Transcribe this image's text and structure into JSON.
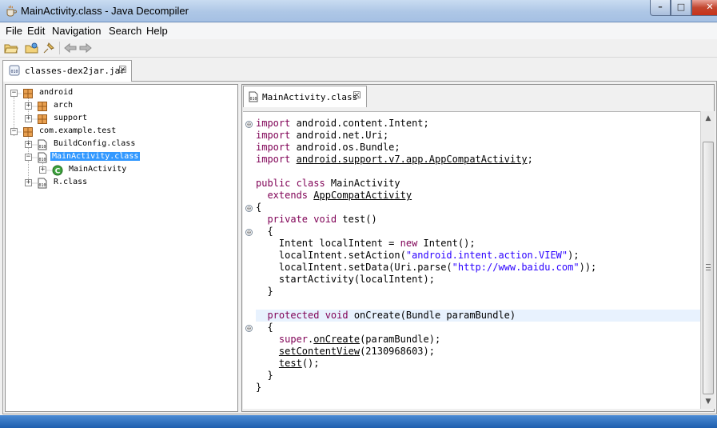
{
  "window": {
    "title": "MainActivity.class - Java Decompiler"
  },
  "menu": {
    "items": [
      "File",
      "Edit",
      "Navigation",
      "Search",
      "Help"
    ]
  },
  "toolbar": {
    "icons": [
      "open-folder-icon",
      "open-type-icon",
      "pin-icon",
      "back-arrow-icon",
      "forward-arrow-icon"
    ]
  },
  "outer_tab": {
    "label": "classes-dex2jar.jar",
    "close_glyph": "☒"
  },
  "tree": {
    "nodes": [
      {
        "label": "android",
        "icon": "package-icon",
        "expander": "−",
        "selected": false
      },
      {
        "label": "arch",
        "icon": "package-icon",
        "expander": "+",
        "selected": false
      },
      {
        "label": "support",
        "icon": "package-icon",
        "expander": "+",
        "selected": false
      },
      {
        "label": "com.example.test",
        "icon": "package-icon",
        "expander": "−",
        "selected": false
      },
      {
        "label": "BuildConfig.class",
        "icon": "class-file-icon",
        "expander": "+",
        "selected": false
      },
      {
        "label": "MainActivity.class",
        "icon": "class-file-icon",
        "expander": "−",
        "selected": true
      },
      {
        "label": "MainActivity",
        "icon": "class-icon",
        "expander": "+",
        "selected": false
      },
      {
        "label": "R.class",
        "icon": "class-file-icon",
        "expander": "+",
        "selected": false
      }
    ]
  },
  "editor": {
    "tab_label": "MainActivity.class",
    "close_glyph": "☒",
    "lines": [
      [
        {
          "t": "import",
          "k": "kw"
        },
        {
          "t": " android.content.Intent;"
        }
      ],
      [
        {
          "t": "import",
          "k": "kw"
        },
        {
          "t": " android.net.Uri;"
        }
      ],
      [
        {
          "t": "import",
          "k": "kw"
        },
        {
          "t": " android.os.Bundle;"
        }
      ],
      [
        {
          "t": "import",
          "k": "kw"
        },
        {
          "t": " "
        },
        {
          "t": "android.support.v7.app.AppCompatActivity",
          "k": "ul"
        },
        {
          "t": ";"
        }
      ],
      [],
      [
        {
          "t": "public class",
          "k": "kw"
        },
        {
          "t": " MainActivity"
        }
      ],
      [
        {
          "t": "  "
        },
        {
          "t": "extends",
          "k": "kw"
        },
        {
          "t": " "
        },
        {
          "t": "AppCompatActivity",
          "k": "ul"
        }
      ],
      [
        {
          "t": "{"
        }
      ],
      [
        {
          "t": "  "
        },
        {
          "t": "private void",
          "k": "kw"
        },
        {
          "t": " test()"
        }
      ],
      [
        {
          "t": "  {"
        }
      ],
      [
        {
          "t": "    Intent localIntent = "
        },
        {
          "t": "new",
          "k": "kw"
        },
        {
          "t": " Intent();"
        }
      ],
      [
        {
          "t": "    localIntent.setAction("
        },
        {
          "t": "\"android.intent.action.VIEW\"",
          "k": "str"
        },
        {
          "t": ");"
        }
      ],
      [
        {
          "t": "    localIntent.setData(Uri.parse("
        },
        {
          "t": "\"http://www.baidu.com\"",
          "k": "str"
        },
        {
          "t": "));"
        }
      ],
      [
        {
          "t": "    startActivity(localIntent);"
        }
      ],
      [
        {
          "t": "  }"
        }
      ],
      [],
      [
        {
          "t": "  "
        },
        {
          "t": "protected void",
          "k": "kw"
        },
        {
          "t": " onCreate(Bundle paramBundle)"
        }
      ],
      [
        {
          "t": "  {"
        }
      ],
      [
        {
          "t": "    "
        },
        {
          "t": "super",
          "k": "kw"
        },
        {
          "t": "."
        },
        {
          "t": "onCreate",
          "k": "ul"
        },
        {
          "t": "(paramBundle);"
        }
      ],
      [
        {
          "t": "    "
        },
        {
          "t": "setContentView",
          "k": "ul"
        },
        {
          "t": "(2130968603);"
        }
      ],
      [
        {
          "t": "    "
        },
        {
          "t": "test",
          "k": "ul"
        },
        {
          "t": "();"
        }
      ],
      [
        {
          "t": "  }"
        }
      ],
      [
        {
          "t": "}"
        }
      ]
    ],
    "fold_markers": [
      "⊖",
      "⊖",
      "⊖",
      "⊖",
      "⊖"
    ]
  },
  "scrollbar": {
    "up_glyph": "▲",
    "down_glyph": "▼"
  }
}
